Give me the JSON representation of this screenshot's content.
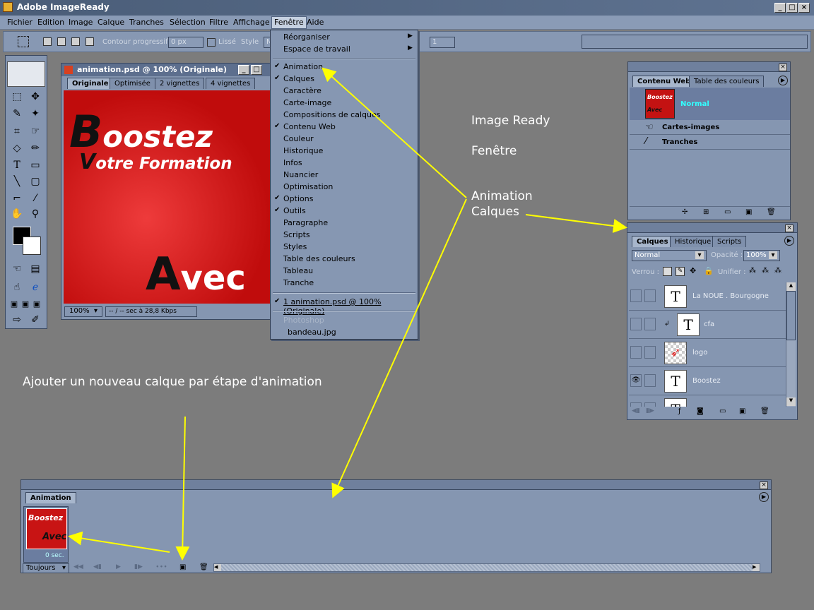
{
  "app": {
    "title": "Adobe ImageReady"
  },
  "menubar": [
    "Fichier",
    "Edition",
    "Image",
    "Calque",
    "Tranches",
    "Sélection",
    "Filtre",
    "Affichage",
    "Fenêtre",
    "Aide"
  ],
  "options": {
    "contour_label": "Contour progressif",
    "contour_value": "0 px",
    "lisse_label": "Lissé",
    "style_label": "Style",
    "style_value": "N",
    "ratio_value": "1"
  },
  "doc": {
    "title": "animation.psd @ 100% (Originale)",
    "tabs": [
      "Originale",
      "Optimisée",
      "2 vignettes",
      "4 vignettes"
    ],
    "zoom": "100%",
    "status": "-- / -- sec à 28,8 Kbps",
    "art": {
      "line1_big": "B",
      "line1_rest": "oostez",
      "line2_big": "V",
      "line2_rest": "otre Formation",
      "line3_big": "A",
      "line3_rest": "vec"
    }
  },
  "fenetre_menu": {
    "items_top": [
      "Réorganiser",
      "Espace de travail"
    ],
    "items": [
      {
        "label": "Animation",
        "checked": true
      },
      {
        "label": "Calques",
        "checked": true
      },
      {
        "label": "Caractère",
        "checked": false
      },
      {
        "label": "Carte-image",
        "checked": false
      },
      {
        "label": "Compositions de calques",
        "checked": false
      },
      {
        "label": "Contenu Web",
        "checked": true
      },
      {
        "label": "Couleur",
        "checked": false
      },
      {
        "label": "Historique",
        "checked": false
      },
      {
        "label": "Infos",
        "checked": false
      },
      {
        "label": "Nuancier",
        "checked": false
      },
      {
        "label": "Optimisation",
        "checked": false
      },
      {
        "label": "Options",
        "checked": true
      },
      {
        "label": "Outils",
        "checked": true
      },
      {
        "label": "Paragraphe",
        "checked": false
      },
      {
        "label": "Scripts",
        "checked": false
      },
      {
        "label": "Styles",
        "checked": false
      },
      {
        "label": "Table des couleurs",
        "checked": false
      },
      {
        "label": "Tableau",
        "checked": false
      },
      {
        "label": "Tranche",
        "checked": false
      }
    ],
    "window_item": "1 animation.psd @ 100% (Originale)",
    "photoshop_label": "Photoshop",
    "photoshop_file": "bandeau.jpg"
  },
  "annotations": {
    "a1": "Image Ready",
    "a2": "Fenêtre",
    "a3": "Animation",
    "a4": "Calques",
    "a5": "Ajouter un nouveau calque par étape d'animation"
  },
  "web_panel": {
    "tabs": [
      "Contenu Web",
      "Table des couleurs"
    ],
    "normal": "Normal",
    "thumb_text": "Boostez",
    "thumb_text2": "Avec",
    "items": [
      "Cartes-images",
      "Tranches"
    ]
  },
  "layers_panel": {
    "tabs": [
      "Calques",
      "Historique",
      "Scripts"
    ],
    "blend": "Normal",
    "opacity_label": "Opacité :",
    "opacity": "100%",
    "verrou_label": "Verrou :",
    "unifier_label": "Unifier :",
    "layers": [
      {
        "name": "La NOUE . Bourgogne",
        "visible": false,
        "thumb": "T"
      },
      {
        "name": "cfa",
        "visible": false,
        "thumb": "T"
      },
      {
        "name": "logo",
        "visible": false,
        "thumb": "logo"
      },
      {
        "name": "Boostez",
        "visible": true,
        "thumb": "T"
      }
    ]
  },
  "animation_panel": {
    "tab": "Animation",
    "frame_delay": "0 sec.",
    "loop": "Toujours"
  },
  "colors": {
    "arrow": "#ffff00",
    "menubar": "#8a9bb6",
    "panel": "#8596b1",
    "art_red": "#d81818"
  }
}
